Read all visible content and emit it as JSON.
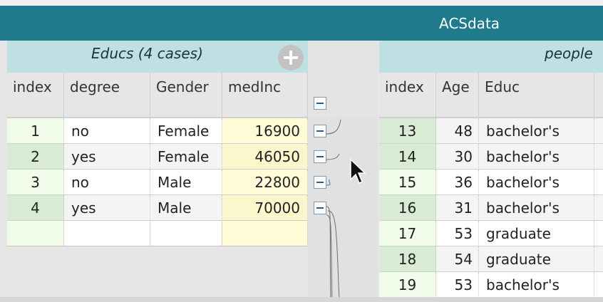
{
  "window": {
    "title": "ACSdata"
  },
  "left_table": {
    "collection_name": "Educs (4 cases)",
    "add_icon": "plus-circle-icon",
    "columns": [
      "index",
      "degree",
      "Gender",
      "medInc"
    ],
    "rows": [
      {
        "index": "1",
        "degree": "no",
        "Gender": "Female",
        "medInc": "16900"
      },
      {
        "index": "2",
        "degree": "yes",
        "Gender": "Female",
        "medInc": "46050"
      },
      {
        "index": "3",
        "degree": "no",
        "Gender": "Male",
        "medInc": "22800"
      },
      {
        "index": "4",
        "degree": "yes",
        "Gender": "Male",
        "medInc": "70000"
      }
    ]
  },
  "right_table": {
    "collection_name": "people",
    "columns": [
      "index",
      "Age",
      "Educ"
    ],
    "rows": [
      {
        "index": "13",
        "Age": "48",
        "Educ": "bachelor's"
      },
      {
        "index": "14",
        "Age": "30",
        "Educ": "bachelor's"
      },
      {
        "index": "15",
        "Age": "36",
        "Educ": "bachelor's"
      },
      {
        "index": "16",
        "Age": "31",
        "Educ": "bachelor's"
      },
      {
        "index": "17",
        "Age": "53",
        "Educ": "graduate"
      },
      {
        "index": "18",
        "Age": "54",
        "Educ": "graduate"
      },
      {
        "index": "19",
        "Age": "53",
        "Educ": "bachelor's"
      }
    ]
  },
  "colors": {
    "titlebar": "#1f7a8c",
    "collection_header": "#bfe0e2",
    "index_light": "#f1fbe9",
    "index_dark": "#d8ebd4",
    "value_highlight": "#fffbd6"
  }
}
